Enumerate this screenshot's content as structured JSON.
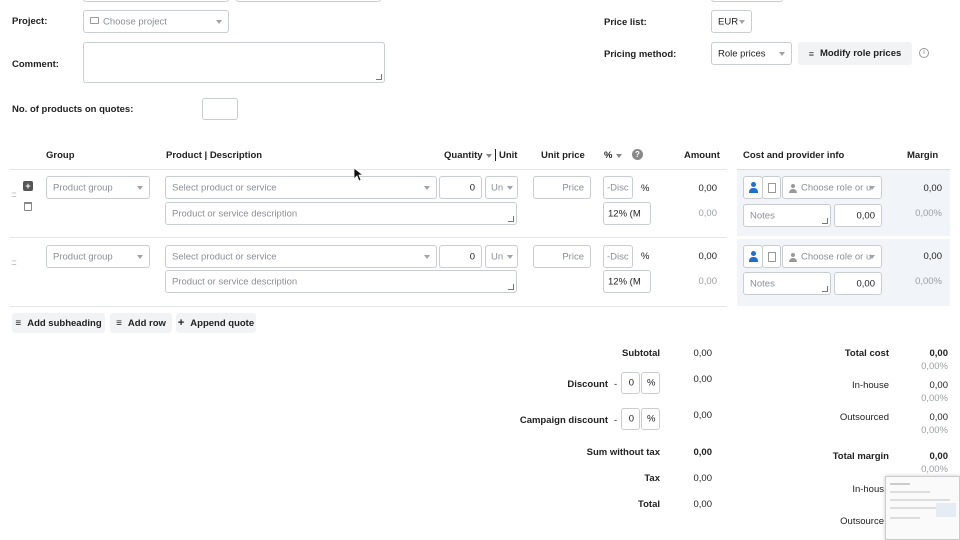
{
  "form": {
    "project_label": "Project:",
    "project_placeholder": "Choose project",
    "comment_label": "Comment:",
    "products_on_quotes_label": "No. of products on quotes:",
    "price_list_label": "Price list:",
    "price_list_value": "EUR",
    "pricing_method_label": "Pricing method:",
    "pricing_method_value": "Role prices",
    "modify_role_prices": "Modify role prices"
  },
  "table": {
    "headers": {
      "group": "Group",
      "product": "Product | Description",
      "quantity": "Quantity",
      "unit": "Unit",
      "unit_price": "Unit price",
      "percent": "%",
      "amount": "Amount",
      "cost_info": "Cost and provider info",
      "margin": "Margin"
    },
    "rows": [
      {
        "group_placeholder": "Product group",
        "product_placeholder": "Select product or service",
        "quantity": "0",
        "unit": "Un",
        "price_placeholder": "Price",
        "discount_placeholder": "-Disc",
        "pct_sign": "%",
        "tax": "12% (M",
        "desc_placeholder": "Product or service description",
        "amount": "0,00",
        "amount_sub": "0,00",
        "role_placeholder": "Choose role or u",
        "notes_placeholder": "Notes",
        "cost": "0,00",
        "margin": "0,00",
        "margin_pct": "0,00%"
      },
      {
        "group_placeholder": "Product group",
        "product_placeholder": "Select product or service",
        "quantity": "0",
        "unit": "Un",
        "price_placeholder": "Price",
        "discount_placeholder": "-Disc",
        "pct_sign": "%",
        "tax": "12% (M",
        "desc_placeholder": "Product or service description",
        "amount": "0,00",
        "amount_sub": "0,00",
        "role_placeholder": "Choose role or u",
        "notes_placeholder": "Notes",
        "cost": "0,00",
        "margin": "0,00",
        "margin_pct": "0,00%"
      }
    ]
  },
  "actions": {
    "add_subheading": "Add subheading",
    "add_row": "Add row",
    "append_quote": "Append quote"
  },
  "totals": {
    "subtotal_label": "Subtotal",
    "subtotal": "0,00",
    "discount_label": "Discount",
    "discount_value": "0",
    "discount_dash": "-",
    "discount_pct": "%",
    "discount_amount": "0,00",
    "campaign_label": "Campaign discount",
    "campaign_value": "0",
    "campaign_dash": "-",
    "campaign_pct": "%",
    "campaign_amount": "0,00",
    "sum_without_tax_label": "Sum without tax",
    "sum_without_tax": "0,00",
    "tax_label": "Tax",
    "tax": "0,00",
    "total_label": "Total",
    "total": "0,00"
  },
  "cost_totals": {
    "total_cost_label": "Total cost",
    "total_cost": "0,00",
    "total_cost_pct": "0,00%",
    "inhouse_label": "In-house",
    "inhouse": "0,00",
    "inhouse_pct": "0,00%",
    "outsourced_label": "Outsourced",
    "outsourced": "0,00",
    "outsourced_pct": "0,00%",
    "total_margin_label": "Total margin",
    "total_margin": "0,00",
    "total_margin_pct": "0,00%",
    "margin_inhouse_label": "In-hous",
    "margin_outsourced_label": "Outsource"
  },
  "colors": {
    "accent_blue": "#1f6fd1",
    "shade": "#f1f4f8",
    "border": "#c9ccd1"
  }
}
